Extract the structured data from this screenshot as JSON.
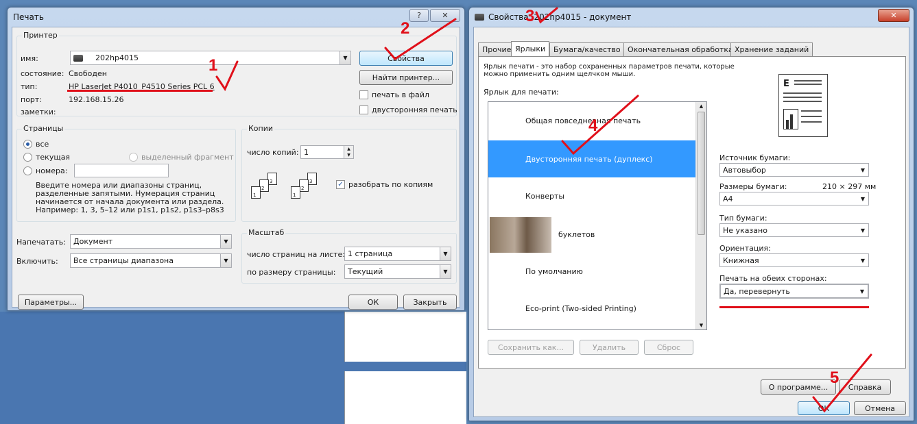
{
  "left_dialog": {
    "title": "Печать",
    "help_label": "?",
    "close_label": "✕",
    "printer_group": "Принтер",
    "name_label": "имя:",
    "printer_name": "202hp4015",
    "status_label": "состояние:",
    "status_value": "Свободен",
    "type_label": "тип:",
    "type_value": "HP LaserJet P4010_P4510 Series PCL 6",
    "port_label": "порт:",
    "port_value": "192.168.15.26",
    "notes_label": "заметки:",
    "properties_button": "Свойства",
    "find_printer_button": "Найти принтер...",
    "print_to_file": "печать в файл",
    "duplex": "двусторонняя печать",
    "pages_group": "Страницы",
    "all": "все",
    "current": "текущая",
    "selection": "выделенный фрагмент",
    "pages": "номера:",
    "pages_hint": [
      "Введите номера или диапазоны страниц,",
      "разделенные запятыми. Нумерация страниц",
      "начинается от начала документа или раздела.",
      "Например: 1, 3, 5–12 или p1s1, p1s2, p1s3–p8s3"
    ],
    "copies_group": "Копии",
    "copies_label": "число копий:",
    "copies_value": "1",
    "collate": "разобрать по копиям",
    "page_nums": [
      "1",
      "2",
      "3"
    ],
    "print_what_label": "Напечатать:",
    "print_what_value": "Документ",
    "include_label": "Включить:",
    "include_value": "Все страницы диапазона",
    "zoom_group": "Масштаб",
    "pages_per_sheet_label": "число страниц на листе:",
    "pages_per_sheet_value": "1 страница",
    "scale_label": "по размеру страницы:",
    "scale_value": "Текущий",
    "options_button": "Параметры...",
    "ok_button": "ОК",
    "close_button": "Закрыть"
  },
  "right_dialog": {
    "title": "Свойства: 202hp4015 - документ",
    "close_label": "✕",
    "tabs": [
      "Прочие",
      "Ярлыки",
      "Бумага/качество",
      "Окончательная обработка",
      "Хранение заданий"
    ],
    "description": [
      "Ярлык печати - это набор сохраненных параметров печати, которые",
      "можно применить одним щелчком мыши."
    ],
    "shortcuts_label": "Ярлык для печати:",
    "shortcuts": [
      "Общая повседневная печать",
      "Двусторонняя печать (дуплекс)",
      "Конверты",
      "буклетов",
      "По умолчанию",
      "Eco-print (Two-sided Printing)"
    ],
    "save_as_button": "Сохранить как...",
    "delete_button": "Удалить",
    "reset_button": "Сброс",
    "paper_source_label": "Источник бумаги:",
    "paper_source_value": "Автовыбор",
    "paper_size_label": "Размеры бумаги:",
    "paper_size_dims": "210 × 297 мм",
    "paper_size_value": "A4",
    "paper_type_label": "Тип бумаги:",
    "paper_type_value": "Не указано",
    "orientation_label": "Ориентация:",
    "orientation_value": "Книжная",
    "both_sides_label": "Печать на обеих сторонах:",
    "both_sides_value": "Да, перевернуть",
    "about_button": "О программе...",
    "help_button": "Справка",
    "ok_button": "ОК",
    "cancel_button": "Отмена"
  },
  "annotations": [
    "1",
    "2",
    "3",
    "4",
    "5"
  ],
  "colors": {
    "annotation": "#e0101a",
    "selection": "#3399ff"
  }
}
